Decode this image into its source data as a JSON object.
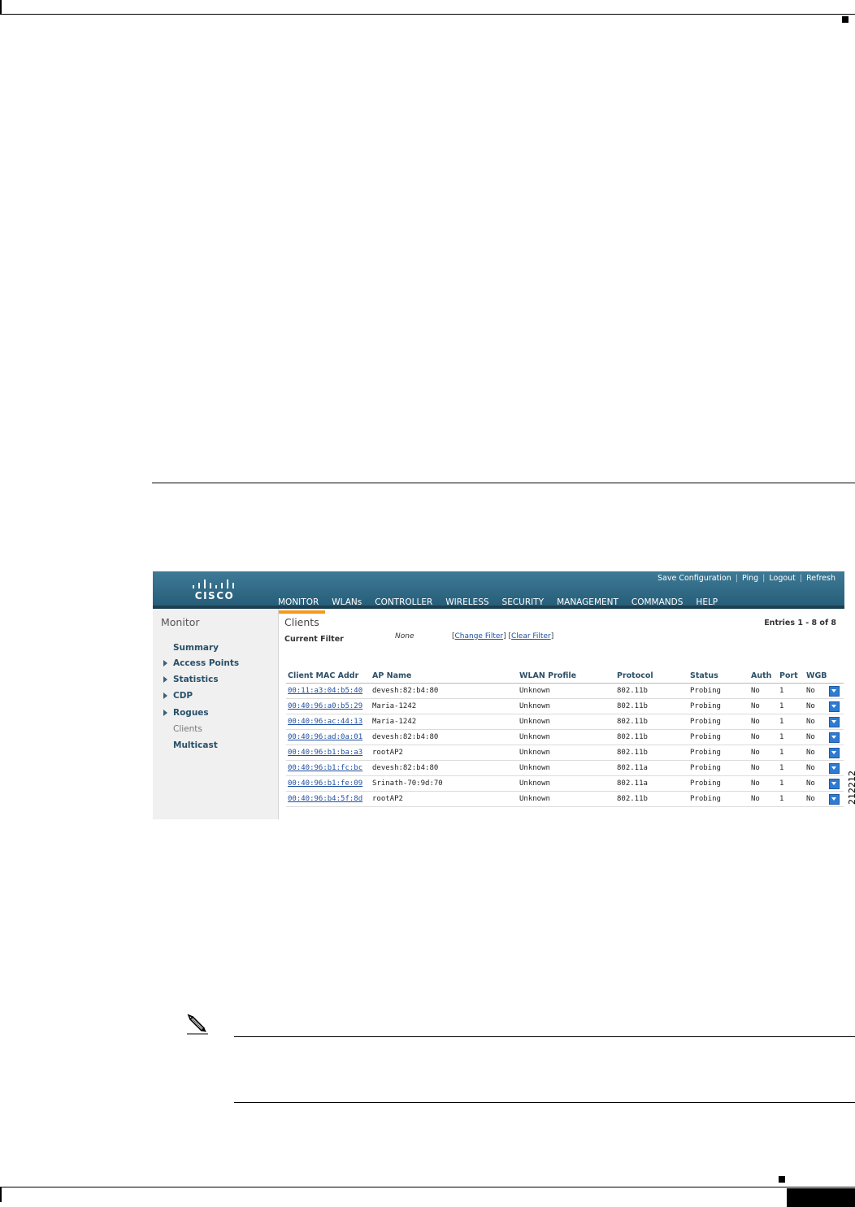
{
  "screenshot": {
    "brand": "CISCO",
    "utility_links": [
      "Save Configuration",
      "Ping",
      "Logout",
      "Refresh"
    ],
    "tabs": [
      "MONITOR",
      "WLANs",
      "CONTROLLER",
      "WIRELESS",
      "SECURITY",
      "MANAGEMENT",
      "COMMANDS",
      "HELP"
    ],
    "active_tab": "MONITOR",
    "sidebar": {
      "title": "Monitor",
      "items": [
        {
          "label": "Summary",
          "expandable": false
        },
        {
          "label": "Access Points",
          "expandable": true
        },
        {
          "label": "Statistics",
          "expandable": true
        },
        {
          "label": "CDP",
          "expandable": true
        },
        {
          "label": "Rogues",
          "expandable": true
        },
        {
          "label": "Clients",
          "expandable": false,
          "current": true
        },
        {
          "label": "Multicast",
          "expandable": false
        }
      ]
    },
    "main": {
      "title": "Clients",
      "entries": "Entries 1 - 8 of 8",
      "filter_label": "Current Filter",
      "filter_value": "None",
      "change_filter": "Change Filter",
      "clear_filter": "Clear Filter",
      "columns": [
        "Client MAC Addr",
        "AP Name",
        "WLAN Profile",
        "Protocol",
        "Status",
        "Auth",
        "Port",
        "WGB"
      ],
      "rows": [
        [
          "00:11:a3:04:b5:40",
          "devesh:82:b4:80",
          "Unknown",
          "802.11b",
          "Probing",
          "No",
          "1",
          "No"
        ],
        [
          "00:40:96:a0:b5:29",
          "Maria-1242",
          "Unknown",
          "802.11b",
          "Probing",
          "No",
          "1",
          "No"
        ],
        [
          "00:40:96:ac:44:13",
          "Maria-1242",
          "Unknown",
          "802.11b",
          "Probing",
          "No",
          "1",
          "No"
        ],
        [
          "00:40:96:ad:0a:01",
          "devesh:82:b4:80",
          "Unknown",
          "802.11b",
          "Probing",
          "No",
          "1",
          "No"
        ],
        [
          "00:40:96:b1:ba:a3",
          "rootAP2",
          "Unknown",
          "802.11b",
          "Probing",
          "No",
          "1",
          "No"
        ],
        [
          "00:40:96:b1:fc:bc",
          "devesh:82:b4:80",
          "Unknown",
          "802.11a",
          "Probing",
          "No",
          "1",
          "No"
        ],
        [
          "00:40:96:b1:fe:09",
          "Srinath-70:9d:70",
          "Unknown",
          "802.11a",
          "Probing",
          "No",
          "1",
          "No"
        ],
        [
          "00:40:96:b4:5f:8d",
          "rootAP2",
          "Unknown",
          "802.11b",
          "Probing",
          "No",
          "1",
          "No"
        ]
      ]
    }
  },
  "figure_id": "212212",
  "colors": {
    "header": "#2f6b88",
    "tab_underline": "#f49a1c",
    "link": "#1f4fa0",
    "dropdown": "#2f7bd2"
  }
}
